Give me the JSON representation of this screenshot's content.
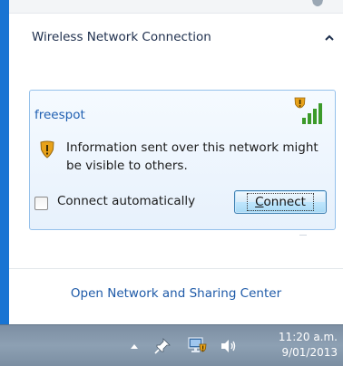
{
  "flyout": {
    "section_title": "Wireless Network Connection",
    "network": {
      "name": "freespot",
      "warning": "Information sent over this network might be visible to others.",
      "auto_connect_label": "Connect automatically",
      "auto_connect_checked": false,
      "connect_label_accesskey": "C",
      "connect_label_rest": "onnect",
      "signal_icon": "signal-bars-warning-icon",
      "warning_icon": "shield-warning-icon"
    },
    "footer_link": "Open Network and Sharing Center"
  },
  "taskbar": {
    "icons": [
      "show-hidden-icons-icon",
      "pin-icon",
      "network-warning-icon",
      "speaker-icon"
    ],
    "clock": {
      "time": "11:20 a.m.",
      "date": "9/01/2013"
    }
  },
  "colors": {
    "accent": "#1874d3",
    "link": "#1e5aa8",
    "signal_green": "#3c9a2a",
    "warning_orange": "#e8a21a"
  }
}
